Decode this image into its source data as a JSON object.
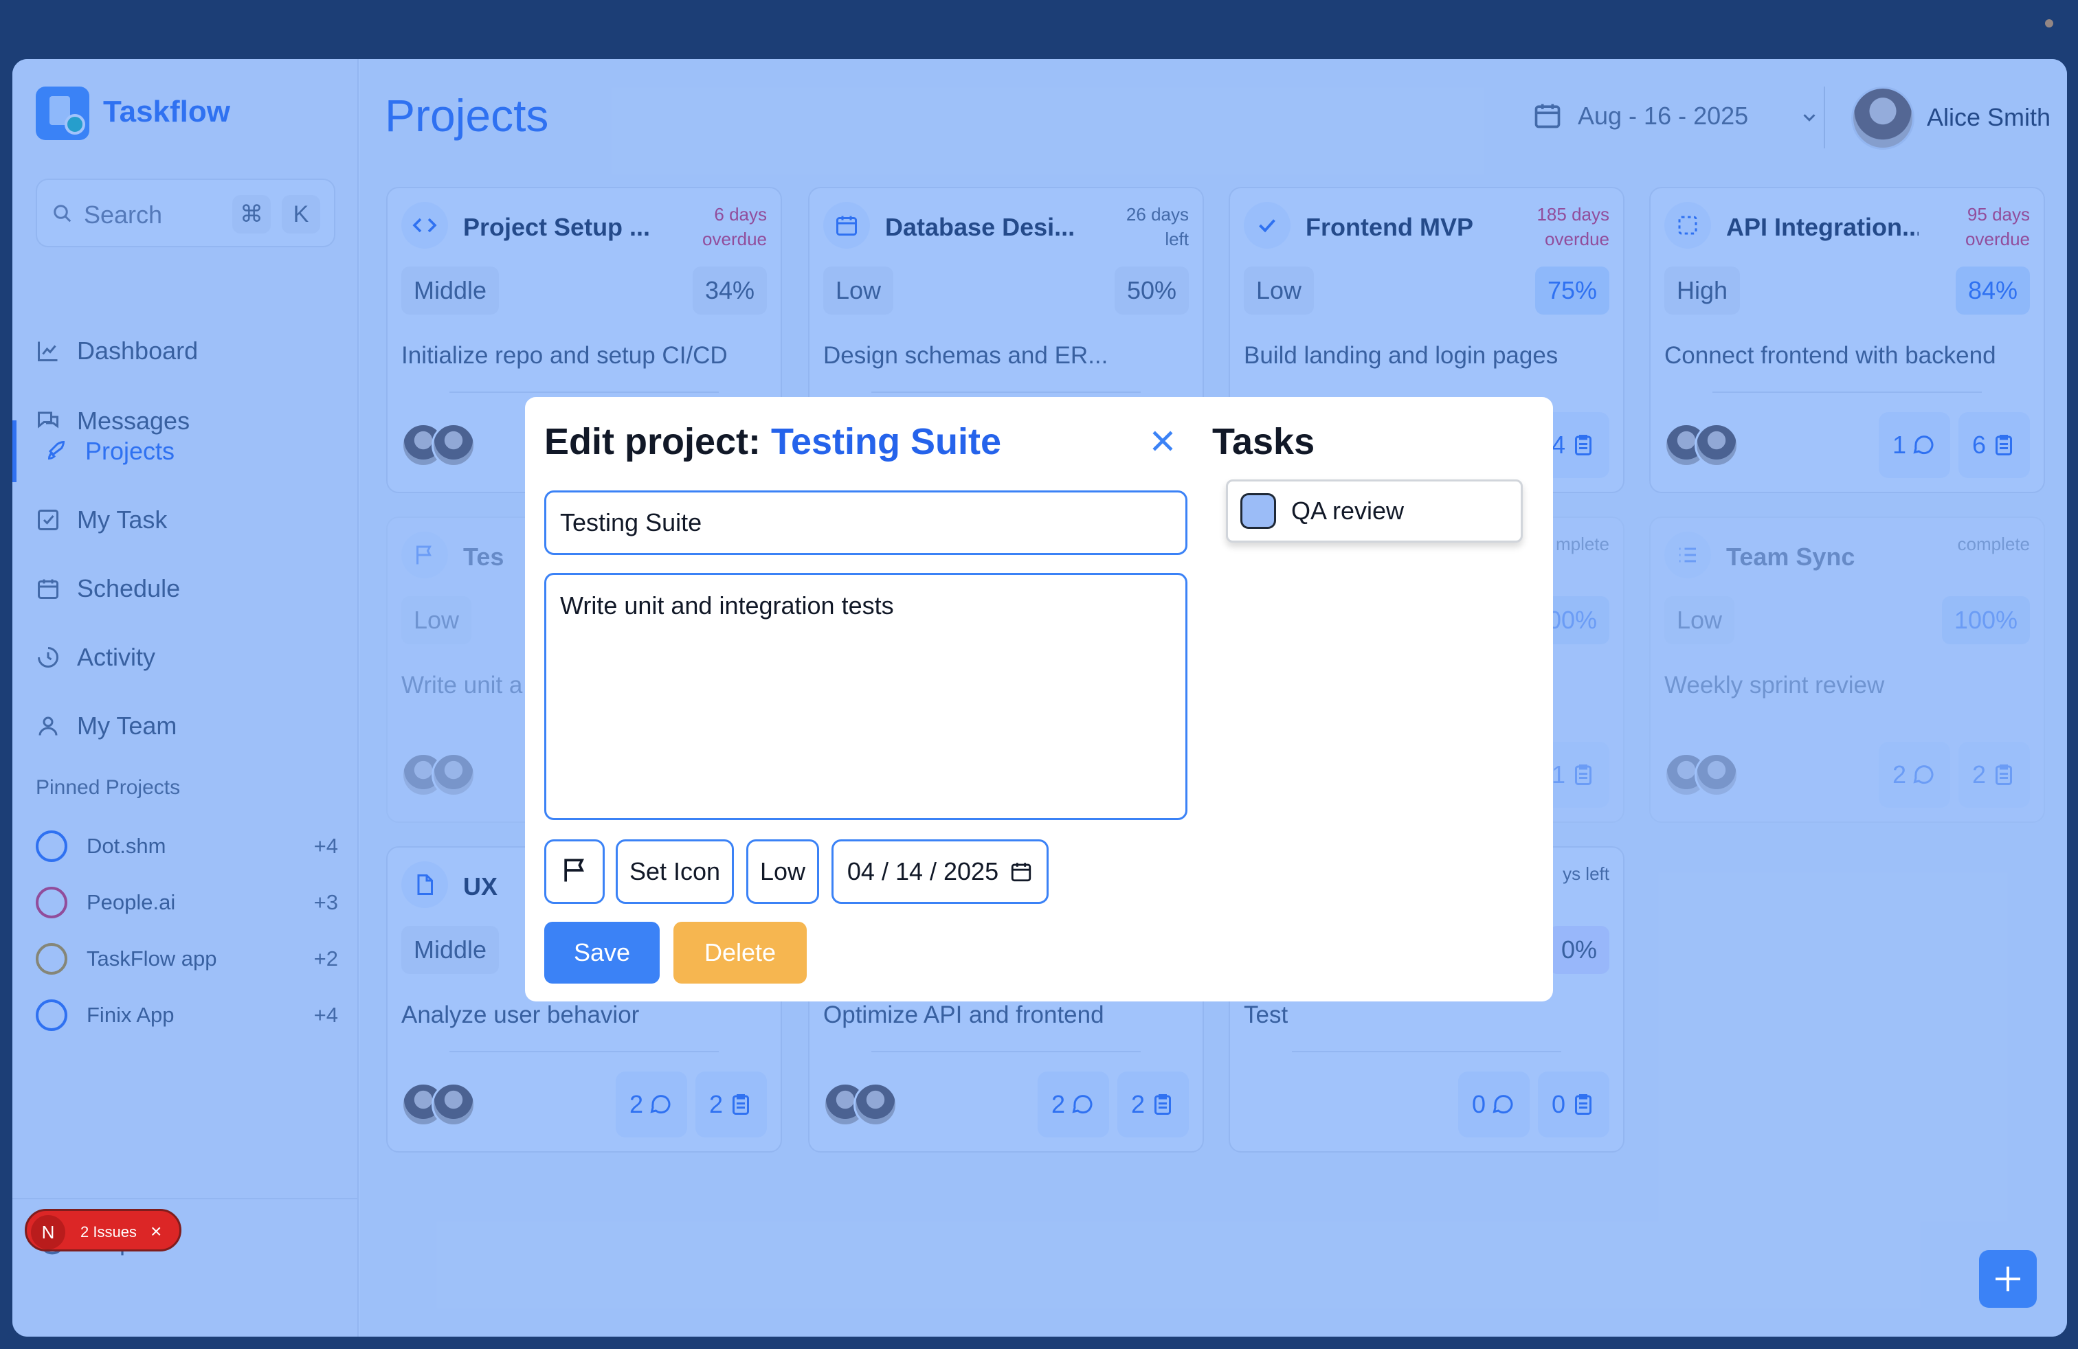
{
  "app": {
    "name": "Taskflow"
  },
  "search": {
    "placeholder": "Search",
    "kbd1": "⌘",
    "kbd2": "K"
  },
  "nav": [
    {
      "label": "Dashboard",
      "icon": "chart-icon"
    },
    {
      "label": "Messages",
      "icon": "messages-icon"
    },
    {
      "label": "Projects",
      "icon": "rocket-icon",
      "active": true
    },
    {
      "label": "My Task",
      "icon": "checkbox-icon"
    },
    {
      "label": "Schedule",
      "icon": "calendar-icon"
    },
    {
      "label": "Activity",
      "icon": "activity-icon"
    },
    {
      "label": "My Team",
      "icon": "user-icon"
    }
  ],
  "pinned": {
    "heading": "Pinned Projects",
    "items": [
      {
        "label": "Dot.shm",
        "count": "+4",
        "color": "#2563eb"
      },
      {
        "label": "People.ai",
        "count": "+3",
        "color": "#e11d48"
      },
      {
        "label": "TaskFlow app",
        "count": "+2",
        "color": "#ca8a04"
      },
      {
        "label": "Finix App",
        "count": "+4",
        "color": "#2563eb"
      }
    ]
  },
  "help": "Help",
  "issues": {
    "badge": "N",
    "label": "2 Issues",
    "close": "×"
  },
  "header": {
    "title": "Projects",
    "date": "Aug - 16 - 2025",
    "user": "Alice Smith"
  },
  "cards": [
    {
      "title": "Project Setup ...",
      "status1": "6 days",
      "status2": "overdue",
      "priority": "Middle",
      "percent": "34%",
      "desc": "Initialize repo and setup CI/CD",
      "comments": "",
      "tasks": ""
    },
    {
      "title": "Database Desi...",
      "status1": "26 days",
      "status2": "left",
      "priority": "Low",
      "percent": "50%",
      "desc": "Design schemas and ER...",
      "comments": "",
      "tasks": ""
    },
    {
      "title": "Frontend MVP",
      "status1": "185 days",
      "status2": "overdue",
      "priority": "Low",
      "percent": "75%",
      "desc": "Build landing and login pages",
      "comments": "",
      "tasks": "4"
    },
    {
      "title": "API Integration...",
      "status1": "95 days",
      "status2": "overdue",
      "priority": "High",
      "percent": "84%",
      "desc": "Connect frontend with backend",
      "comments": "1",
      "tasks": "6"
    },
    {
      "title": "Tes",
      "status1": "",
      "status2": "",
      "priority": "Low",
      "percent": "",
      "desc": "Write unit a",
      "comments": "",
      "tasks": ""
    },
    {
      "title": "",
      "status1": "mplete",
      "status2": "",
      "priority": "",
      "percent": "00%",
      "desc": "",
      "comments": "",
      "tasks": "1"
    },
    {
      "title": "Team Sync",
      "status1": "complete",
      "status2": "",
      "priority": "Low",
      "percent": "100%",
      "desc": "Weekly sprint review",
      "comments": "2",
      "tasks": "2"
    },
    {
      "title": "UX",
      "status1": "",
      "status2": "",
      "priority": "Middle",
      "percent": "",
      "desc": "Analyze user behavior",
      "comments": "2",
      "tasks": "2"
    },
    {
      "title": "",
      "status1": "",
      "status2": "",
      "priority": "",
      "percent": "",
      "desc": "Optimize API and frontend",
      "comments": "2",
      "tasks": "2"
    },
    {
      "title": "",
      "status1": "ys left",
      "status2": "",
      "priority": "",
      "percent": "0%",
      "desc": "Test",
      "comments": "0",
      "tasks": "0"
    }
  ],
  "modal": {
    "title_prefix": "Edit project: ",
    "title_project": "Testing Suite",
    "name_value": "Testing Suite",
    "description_value": "Write unit and integration tests",
    "set_icon": "Set Icon",
    "priority": "Low",
    "date": "04 / 14 / 2025",
    "save": "Save",
    "delete": "Delete",
    "tasks_heading": "Tasks",
    "tasks": [
      {
        "label": "QA review"
      }
    ]
  }
}
